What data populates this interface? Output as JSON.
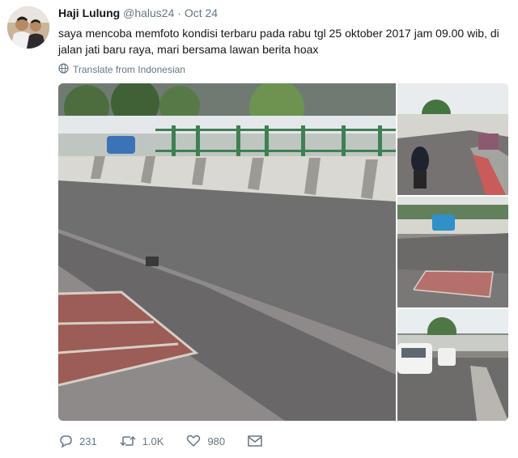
{
  "tweet": {
    "author_name": "Haji Lulung",
    "author_handle": "@halus24",
    "separator": "·",
    "timestamp": "Oct 24",
    "text": "saya mencoba memfoto kondisi terbaru pada rabu tgl 25 oktober 2017  jam 09.00 wib, di jalan jati baru raya, mari bersama lawan berita hoax",
    "translate_label": "Translate from Indonesian"
  },
  "actions": {
    "reply_count": "231",
    "retweet_count": "1.0K",
    "like_count": "980"
  },
  "icons": [
    "globe-icon",
    "reply-icon",
    "retweet-icon",
    "like-icon",
    "message-icon"
  ]
}
